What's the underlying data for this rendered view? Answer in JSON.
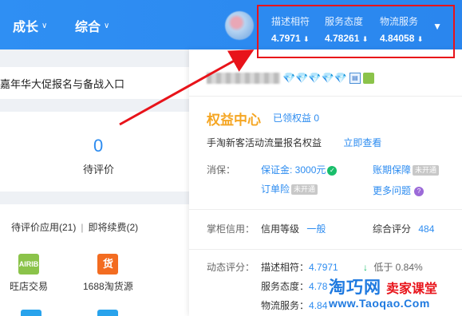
{
  "nav": {
    "items": [
      {
        "label": "成长"
      },
      {
        "label": "综合"
      }
    ]
  },
  "metrics": [
    {
      "label": "描述相符",
      "value": "4.7971",
      "trend": "⬇"
    },
    {
      "label": "服务态度",
      "value": "4.78261",
      "trend": "⬇"
    },
    {
      "label": "物流服务",
      "value": "4.84058",
      "trend": "⬇"
    }
  ],
  "metrics_caret": "▼",
  "banner": {
    "text": "嘉年华大促报名与备战入口"
  },
  "pending": {
    "count": "0",
    "label": "待评价"
  },
  "apps": {
    "tab1": "待评价应用(21)",
    "separator": "|",
    "tab2": "即将续费(2)",
    "items": [
      {
        "label": "旺店交易",
        "icon_text": "AIRIB",
        "color": "#8bc34a"
      },
      {
        "label": "1688淘货源",
        "icon_text": "货",
        "color": "#f36c21"
      }
    ]
  },
  "panel": {
    "diamonds": "💎💎💎💎💎",
    "quanyi_title": "权益中心",
    "yiling": "已领权益 0",
    "promo_text": "手淘新客活动流量报名权益",
    "promo_link": "立即查看",
    "xiaobao_label": "消保：",
    "baozhengjin": "保证金: 3000元",
    "zhangqi": "账期保障",
    "not_open": "未开通",
    "dingdan": "订单险",
    "more_q": "更多问题",
    "zhanggui_label": "掌柜信用：",
    "xinyong_label": "信用等级",
    "xinyong_value": "一般",
    "zonghe_label": "综合评分",
    "zonghe_value": "484",
    "dongtai_label": "动态评分：",
    "dsr": [
      {
        "label": "描述相符：",
        "value": "4.7971",
        "compare": "低于 0.84%"
      },
      {
        "label": "服务态度：",
        "value": "4.78"
      },
      {
        "label": "物流服务：",
        "value": "4.84"
      }
    ]
  },
  "watermark": {
    "brand": "淘巧网",
    "sub": "卖家课堂",
    "url": "www.Taoqao.Com"
  },
  "colors": {
    "header": "#2d8cf0",
    "highlight": "#e8131a",
    "accent_orange": "#f5a623",
    "link": "#2d8cf0"
  }
}
